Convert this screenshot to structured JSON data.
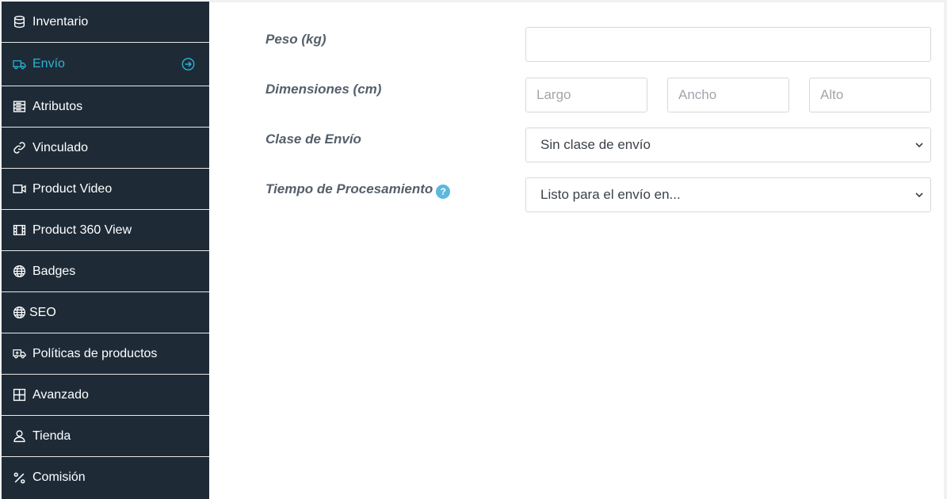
{
  "sidebar": {
    "items": [
      {
        "label": "Inventario",
        "icon": "database-icon",
        "name": "sidebar-item-inventario"
      },
      {
        "label": "Envío",
        "icon": "truck-icon",
        "name": "sidebar-item-envio",
        "active": true
      },
      {
        "label": "Atributos",
        "icon": "server-icon",
        "name": "sidebar-item-atributos"
      },
      {
        "label": "Vinculado",
        "icon": "link-icon",
        "name": "sidebar-item-vinculado"
      },
      {
        "label": "Product Video",
        "icon": "video-icon",
        "name": "sidebar-item-product-video"
      },
      {
        "label": "Product 360 View",
        "icon": "film-icon",
        "name": "sidebar-item-product-360-view"
      },
      {
        "label": "Badges",
        "icon": "globe-icon",
        "name": "sidebar-item-badges"
      },
      {
        "label": "SEO",
        "icon": "globe-icon",
        "name": "sidebar-item-seo"
      },
      {
        "label": "Políticas de productos",
        "icon": "ambulance-icon",
        "name": "sidebar-item-politicas"
      },
      {
        "label": "Avanzado",
        "icon": "grid-icon",
        "name": "sidebar-item-avanzado"
      },
      {
        "label": "Tienda",
        "icon": "user-icon",
        "name": "sidebar-item-tienda"
      },
      {
        "label": "Comisión",
        "icon": "percent-icon",
        "name": "sidebar-item-comision"
      }
    ],
    "active_color": "#2ab4d6",
    "background": "#1e2b37"
  },
  "form": {
    "weight": {
      "label": "Peso (kg)",
      "value": ""
    },
    "dimensions": {
      "label": "Dimensiones (cm)",
      "length_placeholder": "Largo",
      "width_placeholder": "Ancho",
      "height_placeholder": "Alto"
    },
    "shipping_class": {
      "label": "Clase de Envío",
      "selected": "Sin clase de envío"
    },
    "processing_time": {
      "label": "Tiempo de Procesamiento",
      "selected": "Listo para el envío en..."
    }
  }
}
